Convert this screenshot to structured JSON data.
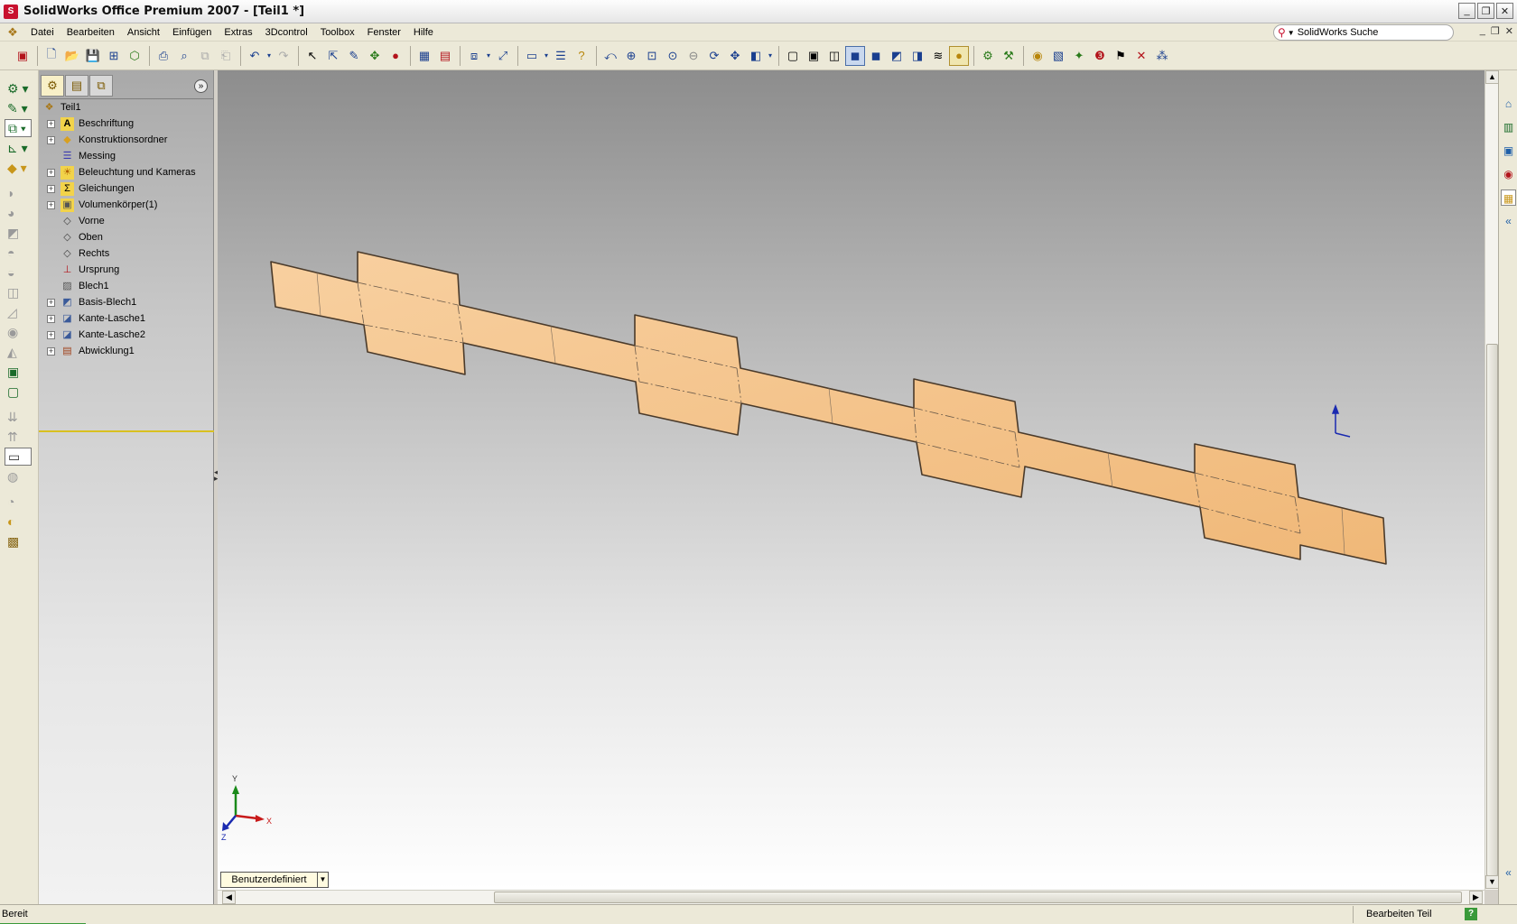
{
  "window": {
    "title": "SolidWorks Office Premium 2007 - [Teil1 *]",
    "controls": [
      "_",
      "❐",
      "✕"
    ]
  },
  "menu": {
    "items": [
      "Datei",
      "Bearbeiten",
      "Ansicht",
      "Einfügen",
      "Extras",
      "3Dcontrol",
      "Toolbox",
      "Fenster",
      "Hilfe"
    ],
    "search_placeholder": "SolidWorks Suche",
    "doc_controls": [
      "_",
      "❐",
      "✕"
    ]
  },
  "feature_tree": {
    "root": "Teil1",
    "items": [
      {
        "label": "Beschriftung",
        "icon": "annotation-icon",
        "expandable": true
      },
      {
        "label": "Konstruktionsordner",
        "icon": "design-folder-icon",
        "expandable": true
      },
      {
        "label": "Messing",
        "icon": "material-icon",
        "expandable": false
      },
      {
        "label": "Beleuchtung und Kameras",
        "icon": "lights-icon",
        "expandable": true
      },
      {
        "label": "Gleichungen",
        "icon": "equations-icon",
        "expandable": true
      },
      {
        "label": "Volumenkörper(1)",
        "icon": "solid-bodies-icon",
        "expandable": true
      },
      {
        "label": "Vorne",
        "icon": "plane-icon",
        "expandable": false
      },
      {
        "label": "Oben",
        "icon": "plane-icon",
        "expandable": false
      },
      {
        "label": "Rechts",
        "icon": "plane-icon",
        "expandable": false
      },
      {
        "label": "Ursprung",
        "icon": "origin-icon",
        "expandable": false
      },
      {
        "label": "Blech1",
        "icon": "sheet-metal-icon",
        "expandable": false
      },
      {
        "label": "Basis-Blech1",
        "icon": "base-flange-icon",
        "expandable": true
      },
      {
        "label": "Kante-Lasche1",
        "icon": "edge-flange-icon",
        "expandable": true
      },
      {
        "label": "Kante-Lasche2",
        "icon": "edge-flange-icon",
        "expandable": true
      },
      {
        "label": "Abwicklung1",
        "icon": "flat-pattern-icon",
        "expandable": true
      }
    ]
  },
  "viewport": {
    "view_name": "Benutzerdefiniert",
    "part_color": "#f5c48f",
    "triad_labels": {
      "x": "X",
      "y": "Y",
      "z": "Z"
    }
  },
  "status": {
    "left": "Bereit",
    "right": "Bearbeiten Teil",
    "help": "?"
  },
  "colors": {
    "accent_red": "#c8102e",
    "rollback_bar": "#d8c020",
    "part_fill": "#f5c48f"
  }
}
